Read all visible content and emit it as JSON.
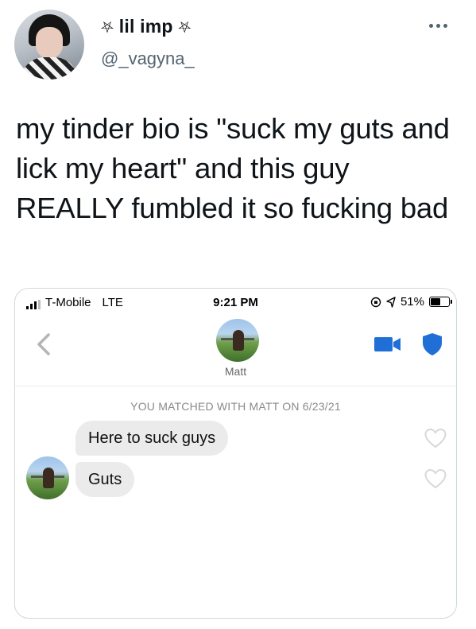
{
  "tweet": {
    "display_name": "lil imp",
    "name_prefix_glyph": "⛧",
    "name_suffix_glyph": "⛧",
    "handle": "@_vagyna_",
    "text": "my tinder bio is \"suck my guts and lick my heart\" and this guy REALLY fumbled it so fucking bad",
    "more_icon": "ellipsis-icon"
  },
  "screenshot": {
    "status_bar": {
      "carrier": "T-Mobile",
      "network": "LTE",
      "time": "9:21 PM",
      "battery": "51%"
    },
    "header": {
      "match_name": "Matt",
      "icons": [
        "back-chevron-icon",
        "video-call-icon",
        "safety-shield-icon"
      ]
    },
    "matched_banner": "YOU MATCHED WITH MATT ON 6/23/21",
    "messages": [
      {
        "text": "Here to suck guys",
        "liked": false
      },
      {
        "text": "Guts",
        "liked": false
      }
    ],
    "colors": {
      "accent_blue": "#1f6fd6",
      "bubble_gray": "#ebebeb",
      "heart_outline": "#d8d8d8"
    }
  }
}
